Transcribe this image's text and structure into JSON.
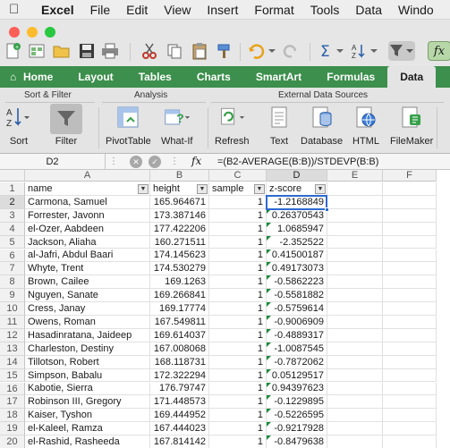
{
  "menubar": {
    "app": "Excel",
    "items": [
      "File",
      "Edit",
      "View",
      "Insert",
      "Format",
      "Tools",
      "Data",
      "Windo"
    ]
  },
  "ribbon_tabs": [
    "Home",
    "Layout",
    "Tables",
    "Charts",
    "SmartArt",
    "Formulas",
    "Data"
  ],
  "active_tab": "Data",
  "ribbon": {
    "groups": {
      "sort_filter": "Sort & Filter",
      "analysis": "Analysis",
      "external": "External Data Sources"
    },
    "buttons": {
      "sort": "Sort",
      "filter": "Filter",
      "pivottable": "PivotTable",
      "whatif": "What-If",
      "refresh": "Refresh",
      "text": "Text",
      "database": "Database",
      "html": "HTML",
      "filemaker": "FileMaker"
    }
  },
  "formula_bar": {
    "name_box": "D2",
    "fx": "fx",
    "formula": "=(B2-AVERAGE(B:B))/STDEVP(B:B)"
  },
  "sheet": {
    "columns": [
      "A",
      "B",
      "C",
      "D",
      "E",
      "F"
    ],
    "rows": [
      [
        "name",
        "height",
        "sample",
        "z-score"
      ],
      [
        "Carmona, Samuel",
        "165.964671",
        "1",
        "-1.2168849"
      ],
      [
        "Forrester, Javonn",
        "173.387146",
        "1",
        "0.26370543"
      ],
      [
        "el-Ozer, Aabdeen",
        "177.422206",
        "1",
        "1.0685947"
      ],
      [
        "Jackson, Aliaha",
        "160.271511",
        "1",
        "-2.352522"
      ],
      [
        "al-Jafri, Abdul Baari",
        "174.145623",
        "1",
        "0.41500187"
      ],
      [
        "Whyte, Trent",
        "174.530279",
        "1",
        "0.49173073"
      ],
      [
        "Brown, Cailee",
        "169.1263",
        "1",
        "-0.5862223"
      ],
      [
        "Nguyen, Sanate",
        "169.266841",
        "1",
        "-0.5581882"
      ],
      [
        "Cress, Janay",
        "169.17774",
        "1",
        "-0.5759614"
      ],
      [
        "Owens, Roman",
        "167.549811",
        "1",
        "-0.9006909"
      ],
      [
        "Hasadinratana, Jaideep",
        "169.614037",
        "1",
        "-0.4889317"
      ],
      [
        "Charleston, Destiny",
        "167.008068",
        "1",
        "-1.0087545"
      ],
      [
        "Tillotson, Robert",
        "168.118731",
        "1",
        "-0.7872062"
      ],
      [
        "Simpson, Babalu",
        "172.322294",
        "1",
        "0.05129517"
      ],
      [
        "Kabotie, Sierra",
        "176.79747",
        "1",
        "0.94397623"
      ],
      [
        "Robinson III, Gregory",
        "171.448573",
        "1",
        "-0.1229895"
      ],
      [
        "Kaiser, Tyshon",
        "169.444952",
        "1",
        "-0.5226595"
      ],
      [
        "el-Kaleel, Ramza",
        "167.444023",
        "1",
        "-0.9217928"
      ],
      [
        "el-Rashid, Rasheeda",
        "167.814142",
        "1",
        "-0.8479638"
      ]
    ]
  },
  "colors": {
    "ribbon_green": "#3c8f4c",
    "selection_blue": "#2e6bd0",
    "error_triangle": "#1a8a3a"
  }
}
